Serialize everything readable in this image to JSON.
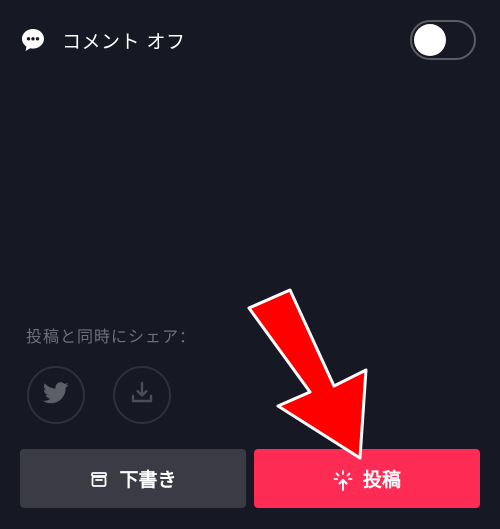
{
  "comment": {
    "icon": "comment-bubble-icon",
    "label": "コメント オフ",
    "toggle_on": false
  },
  "share": {
    "label": "投稿と同時にシェア：",
    "targets": [
      {
        "icon": "twitter-icon"
      },
      {
        "icon": "download-icon"
      }
    ]
  },
  "buttons": {
    "draft_label": "下書き",
    "draft_icon": "draft-box-icon",
    "post_label": "投稿",
    "post_icon": "sparkle-arrow-icon"
  },
  "colors": {
    "background": "#161823",
    "post_button": "#fe2c55",
    "draft_button": "#3a3b44",
    "annotation_arrow": "#ff0000"
  }
}
